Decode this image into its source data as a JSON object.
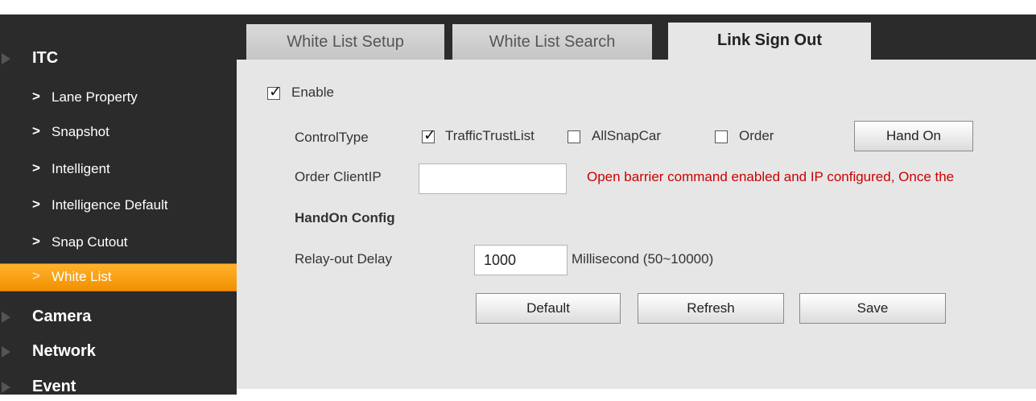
{
  "sidebar": {
    "sections": [
      {
        "label": "ITC"
      },
      {
        "label": "Camera"
      },
      {
        "label": "Network"
      },
      {
        "label": "Event"
      }
    ],
    "itc_items": [
      {
        "label": "Lane Property"
      },
      {
        "label": "Snapshot"
      },
      {
        "label": "Intelligent"
      },
      {
        "label": "Intelligence Default"
      },
      {
        "label": "Snap Cutout"
      },
      {
        "label": "White List"
      }
    ],
    "chevron": ">"
  },
  "tabs": [
    {
      "label": "White List Setup"
    },
    {
      "label": "White List Search"
    },
    {
      "label": "Link Sign Out"
    }
  ],
  "form": {
    "enable_label": "Enable",
    "enable_checked": true,
    "control_type_label": "ControlType",
    "control_options": [
      {
        "label": "TrafficTrustList",
        "checked": true
      },
      {
        "label": "AllSnapCar",
        "checked": false
      },
      {
        "label": "Order",
        "checked": false
      }
    ],
    "hand_on_label": "Hand On",
    "order_client_ip_label": "Order ClientIP",
    "order_client_ip_value": "",
    "warning_text": "Open barrier command enabled and IP configured, Once the",
    "handon_config_label": "HandOn Config",
    "relay_delay_label": "Relay-out Delay",
    "relay_delay_value": "1000",
    "relay_delay_unit": "Millisecond (50~10000)",
    "default_label": "Default",
    "refresh_label": "Refresh",
    "save_label": "Save",
    "checkmark": "✓"
  },
  "colors": {
    "sidebar_bg": "#2b2b2b",
    "active_item": "#f29000",
    "content_bg": "#e6e6e6",
    "warning": "#cc0000"
  }
}
